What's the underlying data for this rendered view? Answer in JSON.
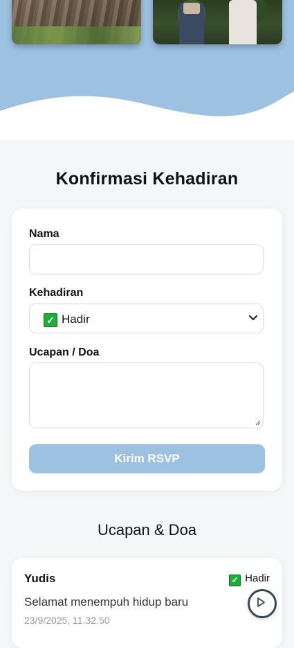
{
  "rsvp": {
    "title": "Konfirmasi Kehadiran",
    "name_label": "Nama",
    "name_value": "",
    "attendance_label": "Kehadiran",
    "attendance_selected": "Hadir",
    "attendance_icon": "check-mark-icon",
    "message_label": "Ucapan / Doa",
    "message_value": "",
    "submit_label": "Kirim RSVP"
  },
  "wishes": {
    "title": "Ucapan & Doa",
    "items": [
      {
        "name": "Yudis",
        "status": "Hadir",
        "message": "Selamat menempuh hidup baru",
        "time": "23/9/2025, 11.32.50"
      }
    ]
  },
  "colors": {
    "accent": "#9dc1e0",
    "check": "#1fae3a"
  }
}
